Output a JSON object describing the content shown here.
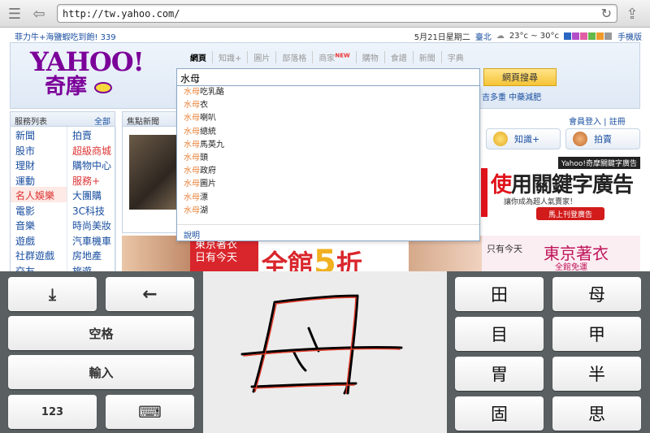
{
  "browser": {
    "url": "http://tw.yahoo.com/"
  },
  "topbar": {
    "promo": "菲力牛+海鹽蝦吃到飽! 339",
    "date": "5月21日星期二",
    "city": "臺北",
    "weather": "23°c ~ 30°c",
    "mobile": "手機版"
  },
  "header": {
    "logo_en": "YAHOO!",
    "logo_zh": "奇摩",
    "search_tabs": [
      "網頁",
      "知識+",
      "圖片",
      "部落格",
      "商家",
      "購物",
      "食譜",
      "新聞",
      "字典"
    ],
    "new_badge": "NEW",
    "search_value": "水母",
    "search_button": "網頁搜尋",
    "trend_links": "吉多重 中藥減肥"
  },
  "suggestions": {
    "prefix": "水母",
    "items": [
      "吃乳酪",
      "衣",
      "喇叭",
      "總統",
      "馬英九",
      "頭",
      "政府",
      "圖片",
      "漂",
      "湖"
    ],
    "footer": "說明"
  },
  "service": {
    "title": "服務列表",
    "all": "全部",
    "items": [
      {
        "label": "新聞",
        "style": ""
      },
      {
        "label": "拍賣",
        "style": ""
      },
      {
        "label": "股市",
        "style": ""
      },
      {
        "label": "超級商城",
        "style": "red"
      },
      {
        "label": "理財",
        "style": ""
      },
      {
        "label": "購物中心",
        "style": ""
      },
      {
        "label": "運動",
        "style": ""
      },
      {
        "label": "服務+",
        "style": "red"
      },
      {
        "label": "名人娛樂",
        "style": "red hl"
      },
      {
        "label": "大團購",
        "style": ""
      },
      {
        "label": "電影",
        "style": ""
      },
      {
        "label": "3C科技",
        "style": ""
      },
      {
        "label": "音樂",
        "style": ""
      },
      {
        "label": "時尚美妝",
        "style": ""
      },
      {
        "label": "遊戲",
        "style": ""
      },
      {
        "label": "汽車機車",
        "style": ""
      },
      {
        "label": "社群遊戲",
        "style": ""
      },
      {
        "label": "房地產",
        "style": ""
      },
      {
        "label": "交友",
        "style": ""
      },
      {
        "label": "旅遊",
        "style": ""
      }
    ]
  },
  "news": {
    "title": "焦點新聞"
  },
  "member": {
    "login": "會員登入",
    "register": "註冊"
  },
  "quick": {
    "knowledge": "知識+",
    "auction": "拍賣"
  },
  "ad": {
    "tag": "Yahoo!奇摩關鍵字廣告",
    "title_red": "使",
    "title_rest": "用關鍵字廣告",
    "sub": "讓你成為超人氣賣家！",
    "button": "馬上刊登廣告"
  },
  "banner_left": {
    "store": "東京著衣",
    "store2": "日有今天",
    "big": "全館",
    "five": "5",
    "zhe": "折"
  },
  "banner_right": {
    "only": "只有今天",
    "logo": "東京著衣",
    "free": "全館免運"
  },
  "keyboard": {
    "space": "空格",
    "enter": "輸入",
    "num": "123",
    "candidates": [
      "田",
      "母",
      "目",
      "甲",
      "胃",
      "半",
      "固",
      "思"
    ]
  },
  "colors": {
    "yahoo_purple": "#7b0099",
    "keyboard_bg": "#5a6062",
    "ad_red": "#e0121a"
  }
}
